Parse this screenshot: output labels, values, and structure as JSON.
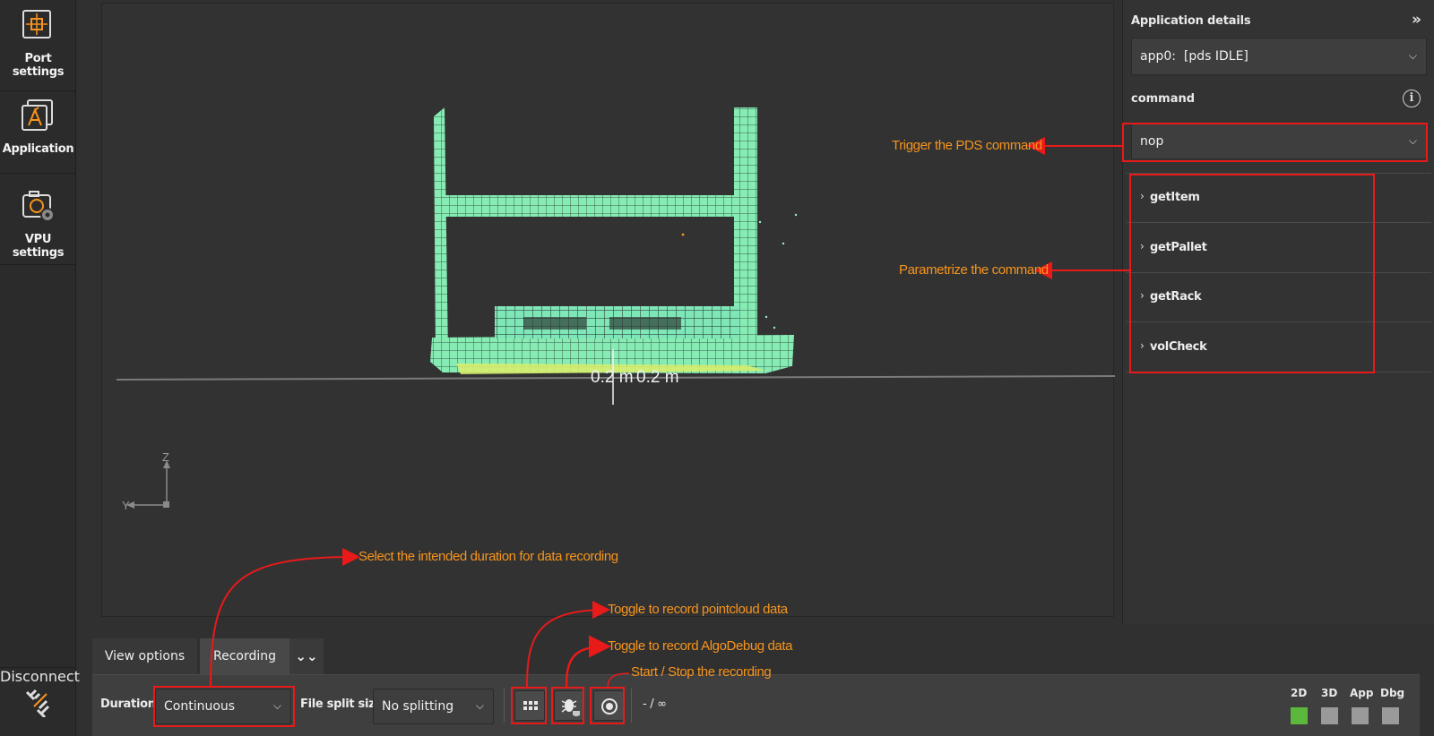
{
  "sidebar": {
    "items": [
      {
        "label": "Port settings",
        "icon": "port-settings-icon"
      },
      {
        "label": "Application",
        "icon": "application-icon"
      },
      {
        "label": "VPU settings",
        "icon": "vpu-settings-icon"
      }
    ],
    "bottom_label": "Disconnect",
    "bottom_icon": "disconnect-icon"
  },
  "viewport": {
    "scale_label_1": "0.2 m",
    "scale_label_2": "0.2 m",
    "axis_z": "Z",
    "axis_y": "Y"
  },
  "right_panel": {
    "title": "Application details",
    "app_select": "app0:  [pds IDLE]",
    "command_label": "command",
    "command_value": "nop",
    "commands": [
      "getItem",
      "getPallet",
      "getRack",
      "volCheck"
    ]
  },
  "bottom": {
    "tabs": [
      "View options",
      "Recording"
    ],
    "duration_label": "Duration",
    "duration_value": "Continuous",
    "split_label": "File split size",
    "split_value": "No splitting",
    "progress_text": "- / ∞",
    "status": [
      {
        "label": "2D",
        "color": "#5bb83a"
      },
      {
        "label": "3D",
        "color": "#9a9a9a"
      },
      {
        "label": "App",
        "color": "#9a9a9a"
      },
      {
        "label": "Dbg",
        "color": "#9a9a9a"
      }
    ]
  },
  "annotations": {
    "trigger": "Trigger the PDS command",
    "parametrize": "Parametrize the command",
    "duration": "Select the intended duration for data recording",
    "pointcloud": "Toggle to record pointcloud data",
    "algodebug": "Toggle to record AlgoDebug data",
    "startstop": "Start / Stop the recording"
  },
  "colors": {
    "annotation_text": "#f7941d",
    "highlight": "#e81a1a",
    "pointcloud": "#7ee8b0",
    "pointcloud_floor": "#dcef6a"
  }
}
